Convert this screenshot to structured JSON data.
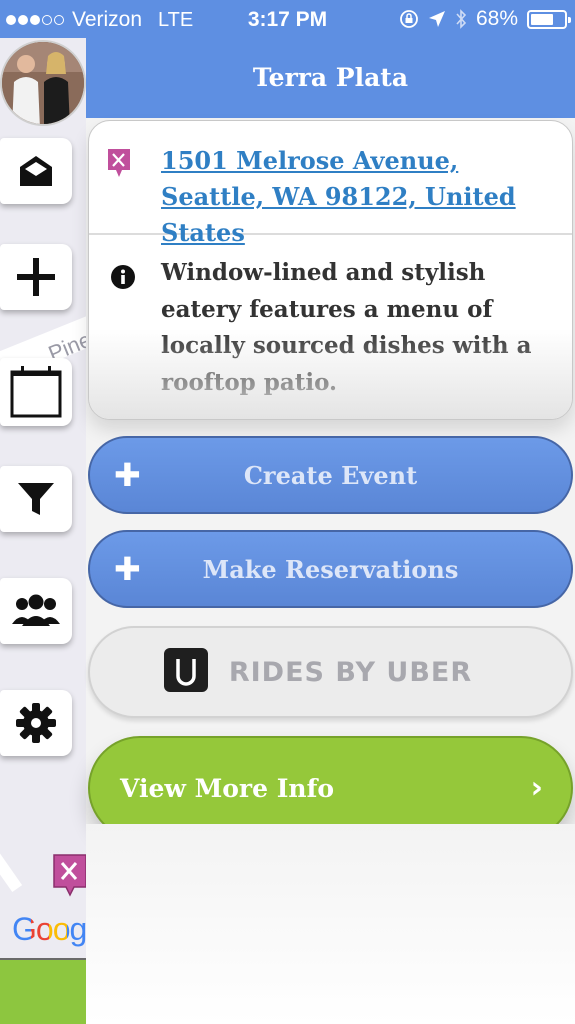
{
  "status_bar": {
    "carrier": "Verizon",
    "network": "LTE",
    "time": "3:17 PM",
    "battery": "68%",
    "battery_level": 0.68,
    "signal_bars": 3,
    "signal_max": 5
  },
  "map": {
    "road_label": "Pine",
    "logo": "Goog"
  },
  "sidebar": {
    "items": [
      {
        "name": "messages",
        "icon": "envelope-icon"
      },
      {
        "name": "add",
        "icon": "plus-icon"
      },
      {
        "name": "calendar",
        "icon": "calendar-icon"
      },
      {
        "name": "filter",
        "icon": "funnel-icon"
      },
      {
        "name": "friends",
        "icon": "group-icon"
      },
      {
        "name": "settings",
        "icon": "gear-icon"
      }
    ]
  },
  "panel": {
    "title": "Terra Plata",
    "address": "1501 Melrose Avenue, Seattle, WA 98122, United States",
    "description": "Window-lined and stylish eatery features a menu of locally sourced dishes with a rooftop patio.",
    "buttons": {
      "create_event": "Create Event",
      "make_reservations": "Make Reservations",
      "rides": "RIDES BY UBER",
      "more_info": "View More Info"
    }
  },
  "colors": {
    "header_blue": "#5e8fe2",
    "button_blue": "#6390e0",
    "green": "#95c83a",
    "link": "#2f7fc4",
    "restaurant_pin": "#c04f9c"
  }
}
